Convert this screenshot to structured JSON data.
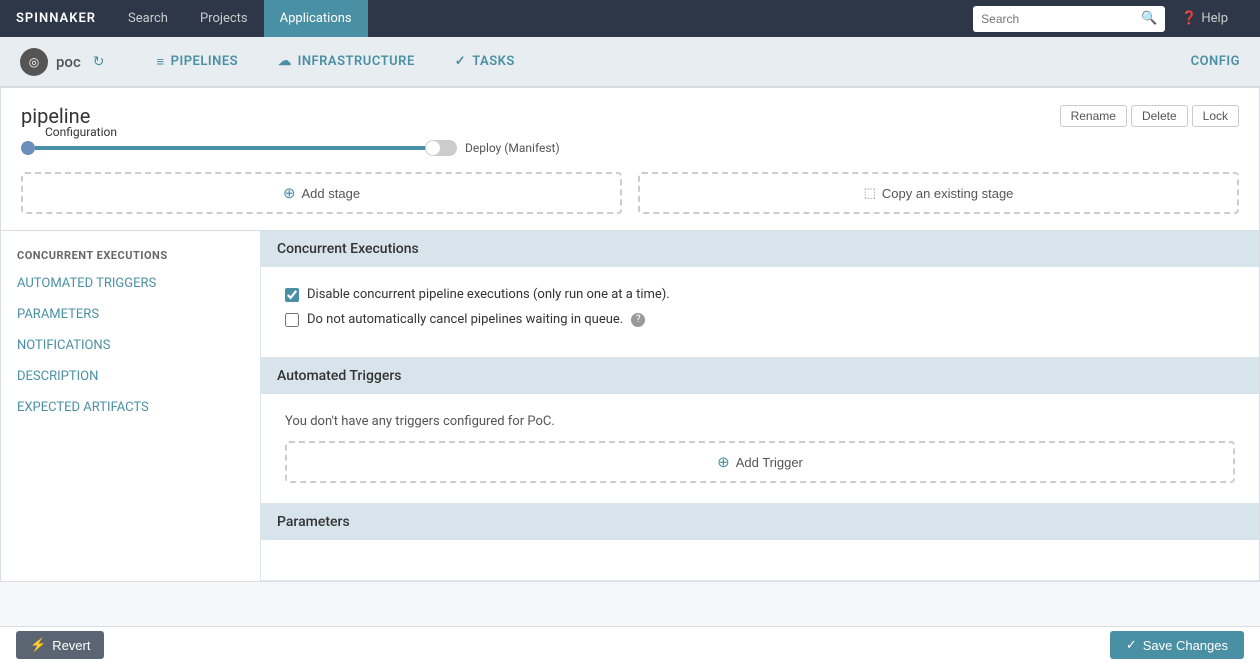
{
  "topNav": {
    "brand": "SPINNAKER",
    "items": [
      {
        "label": "Search",
        "active": false
      },
      {
        "label": "Projects",
        "active": false
      },
      {
        "label": "Applications",
        "active": true
      }
    ],
    "search": {
      "placeholder": "Search"
    },
    "help": {
      "label": "Help"
    }
  },
  "appNav": {
    "logoIcon": "◎",
    "appName": "poc",
    "items": [
      {
        "label": "PIPELINES",
        "icon": "≡"
      },
      {
        "label": "INFRASTRUCTURE",
        "icon": "☁"
      },
      {
        "label": "TASKS",
        "icon": "✓"
      }
    ],
    "config": "CONFIG"
  },
  "pipelineHeader": {
    "title": "pipeline",
    "buttons": [
      "Rename",
      "Delete",
      "Lock"
    ]
  },
  "pipelineDiagram": {
    "configLabel": "Configuration",
    "deployLabel": "Deploy (Manifest)",
    "addStageLabel": "Add stage",
    "copyStageLabel": "Copy an existing stage"
  },
  "sidebar": {
    "sectionHeader": "CONCURRENT EXECUTIONS",
    "items": [
      {
        "label": "AUTOMATED TRIGGERS"
      },
      {
        "label": "PARAMETERS"
      },
      {
        "label": "NOTIFICATIONS"
      },
      {
        "label": "DESCRIPTION"
      },
      {
        "label": "EXPECTED ARTIFACTS"
      }
    ]
  },
  "concurrentExecutions": {
    "sectionTitle": "Concurrent Executions",
    "checkbox1": {
      "label": "Disable concurrent pipeline executions (only run one at a time).",
      "checked": true
    },
    "checkbox2": {
      "label": "Do not automatically cancel pipelines waiting in queue.",
      "checked": false
    }
  },
  "automatedTriggers": {
    "sectionTitle": "Automated Triggers",
    "emptyText": "You don't have any triggers configured for PoC.",
    "addTriggerLabel": "Add Trigger"
  },
  "parameters": {
    "sectionTitle": "Parameters"
  },
  "footer": {
    "revertLabel": "Revert",
    "saveLabel": "Save Changes"
  }
}
